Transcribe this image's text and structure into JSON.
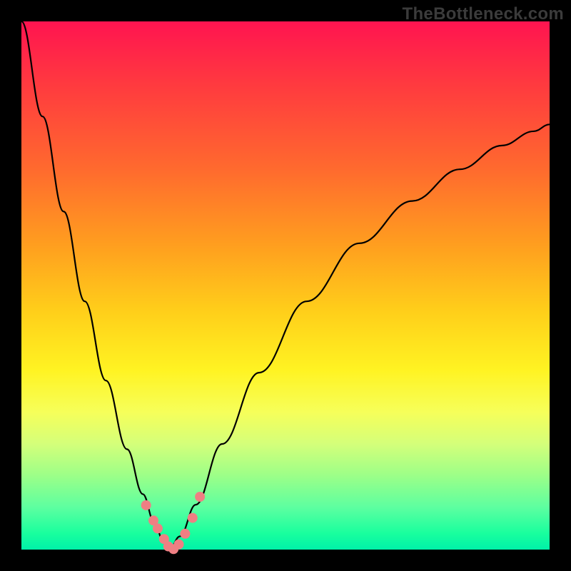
{
  "watermark": "TheBottleneck.com",
  "colors": {
    "frame_bg": "#000000",
    "gradient_top": "#ff1450",
    "gradient_mid": "#fff322",
    "gradient_bottom": "#00f0a8",
    "curve": "#000000",
    "marker": "#ef7f83"
  },
  "chart_data": {
    "type": "line",
    "title": "",
    "xlabel": "",
    "ylabel": "",
    "xlim": [
      0,
      1
    ],
    "ylim": [
      0,
      1
    ],
    "note": "V-shaped curve on vertical rainbow gradient. x and y are normalized to the plot area (0 = left/bottom, 1 = right/top). Curve minimum near x≈0.28.",
    "series": [
      {
        "name": "left-branch",
        "x": [
          0.0,
          0.04,
          0.08,
          0.12,
          0.16,
          0.2,
          0.23,
          0.252,
          0.268,
          0.28
        ],
        "y": [
          1.0,
          0.82,
          0.64,
          0.47,
          0.32,
          0.19,
          0.105,
          0.05,
          0.018,
          0.0
        ]
      },
      {
        "name": "right-branch",
        "x": [
          0.28,
          0.3,
          0.33,
          0.38,
          0.45,
          0.54,
          0.64,
          0.74,
          0.83,
          0.91,
          0.97,
          1.0
        ],
        "y": [
          0.0,
          0.025,
          0.085,
          0.2,
          0.335,
          0.47,
          0.58,
          0.66,
          0.72,
          0.765,
          0.792,
          0.805
        ]
      }
    ],
    "markers": {
      "name": "bottom-cluster",
      "x": [
        0.236,
        0.25,
        0.258,
        0.27,
        0.278,
        0.288,
        0.298,
        0.31,
        0.324,
        0.338
      ],
      "y": [
        0.084,
        0.055,
        0.04,
        0.02,
        0.006,
        0.001,
        0.01,
        0.03,
        0.06,
        0.1
      ],
      "r": 7
    }
  }
}
